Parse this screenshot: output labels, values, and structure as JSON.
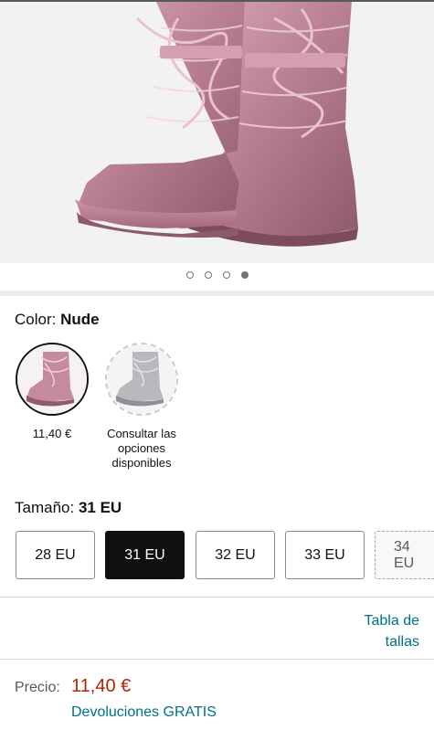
{
  "gallery": {
    "dot_count": 4,
    "active_index": 3
  },
  "color": {
    "label": "Color:",
    "selected": "Nude",
    "options": [
      {
        "caption": "11,40 €",
        "state": "selected"
      },
      {
        "caption": "Consultar las opciones disponibles",
        "state": "unavailable"
      }
    ]
  },
  "size": {
    "label": "Tamaño:",
    "selected": "31 EU",
    "options": [
      {
        "label": "28 EU",
        "state": "available"
      },
      {
        "label": "31 EU",
        "state": "selected"
      },
      {
        "label": "32 EU",
        "state": "available"
      },
      {
        "label": "33 EU",
        "state": "available"
      },
      {
        "label": "34 EU",
        "state": "unavailable"
      }
    ],
    "size_table_link": "Tabla de tallas"
  },
  "price": {
    "label": "Precio:",
    "value": "11,40 €",
    "returns": "Devoluciones GRATIS"
  },
  "colors": {
    "price": "#b12704",
    "link": "#007185",
    "selected_bg": "#0f1111",
    "boot_pink": "#c58a9e"
  }
}
